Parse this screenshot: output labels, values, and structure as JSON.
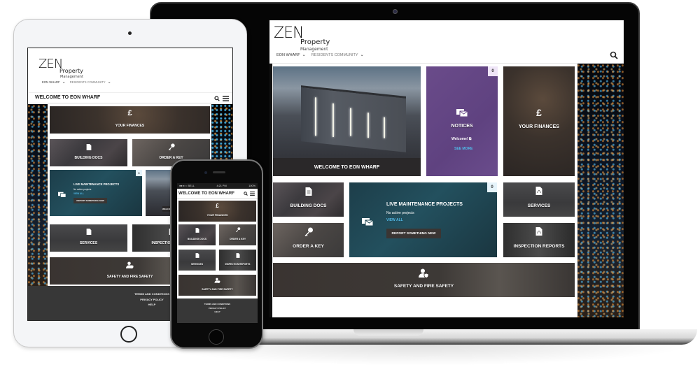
{
  "brand": {
    "logo_main": "ZEN",
    "logo_sub": "Property",
    "logo_tag": "Management"
  },
  "nav": {
    "items": [
      {
        "label": "EON WHARF",
        "has_dropdown": true
      },
      {
        "label": "RESIDENTS COMMUNITY",
        "has_dropdown": true
      }
    ],
    "search_icon": "search-icon",
    "menu_icon": "hamburger-menu-icon"
  },
  "page_title": "WELCOME TO EON WHARF",
  "tiles": {
    "welcome": {
      "label": "WELCOME TO EON WHARF"
    },
    "notices": {
      "label": "NOTICES",
      "icon": "envelopes-icon",
      "badge": "0",
      "latest": "Welcome!",
      "latest_icon": "external-link-icon",
      "see_more": "SEE MORE"
    },
    "finances": {
      "label": "YOUR FINANCES",
      "icon": "pound-sign-icon",
      "glyph": "£"
    },
    "building_docs": {
      "label": "BUILDING DOCS",
      "icon": "document-icon"
    },
    "order_key": {
      "label": "ORDER A KEY",
      "icon": "key-icon"
    },
    "maintenance": {
      "label": "LIVE MAINTENANCE PROJECTS",
      "icon": "envelopes-icon",
      "badge": "0",
      "status": "No active projects",
      "view_all": "VIEW ALL",
      "report_button": "REPORT SOMETHING NEW"
    },
    "services": {
      "label": "SERVICES",
      "icon": "pdf-document-icon"
    },
    "inspection_reports": {
      "label": "INSPECTION REPORTS",
      "icon": "pdf-document-icon"
    },
    "safety": {
      "label": "SAFETY AND FIRE SAFETY",
      "icon": "user-shield-icon"
    }
  },
  "footer": {
    "links": [
      "TERMS AND CONDITIONS",
      "PRIVACY POLICY",
      "HELP"
    ]
  },
  "phone_status": {
    "carrier": "●●●○○ BELL",
    "time": "4:21 PM",
    "battery": "100%"
  },
  "colors": {
    "notices_purple": "#6a4b8a",
    "maintenance_teal": "#1f4753",
    "link_blue": "#51b8e6",
    "footer_dark": "#373737",
    "badge_light_blue": "#e6f4fb"
  }
}
